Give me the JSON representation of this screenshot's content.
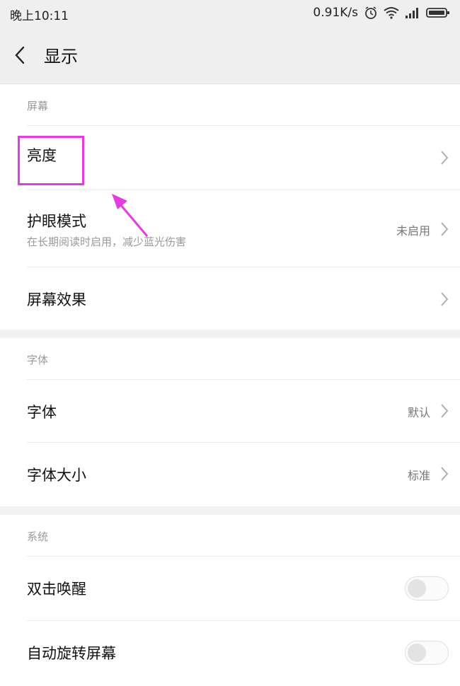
{
  "status_bar": {
    "time": "晚上10:11",
    "net_speed": "0.91K/s",
    "icons": [
      "alarm-icon",
      "wifi-icon",
      "signal-icon",
      "battery-icon"
    ]
  },
  "header": {
    "title": "显示",
    "back_icon": "back-chevron-icon"
  },
  "sections": {
    "screen": {
      "header": "屏幕",
      "brightness": {
        "title": "亮度"
      },
      "eye_care": {
        "title": "护眼模式",
        "subtitle": "在长期阅读时启用，减少蓝光伤害",
        "value": "未启用"
      },
      "screen_effect": {
        "title": "屏幕效果"
      }
    },
    "font": {
      "header": "字体",
      "font": {
        "title": "字体",
        "value": "默认"
      },
      "font_size": {
        "title": "字体大小",
        "value": "标准"
      }
    },
    "system": {
      "header": "系统",
      "double_tap_wake": {
        "title": "双击唤醒",
        "enabled": false
      },
      "auto_rotate": {
        "title": "自动旋转屏幕",
        "enabled": false
      }
    }
  },
  "annotation": {
    "highlight_color": "#e33de0"
  }
}
